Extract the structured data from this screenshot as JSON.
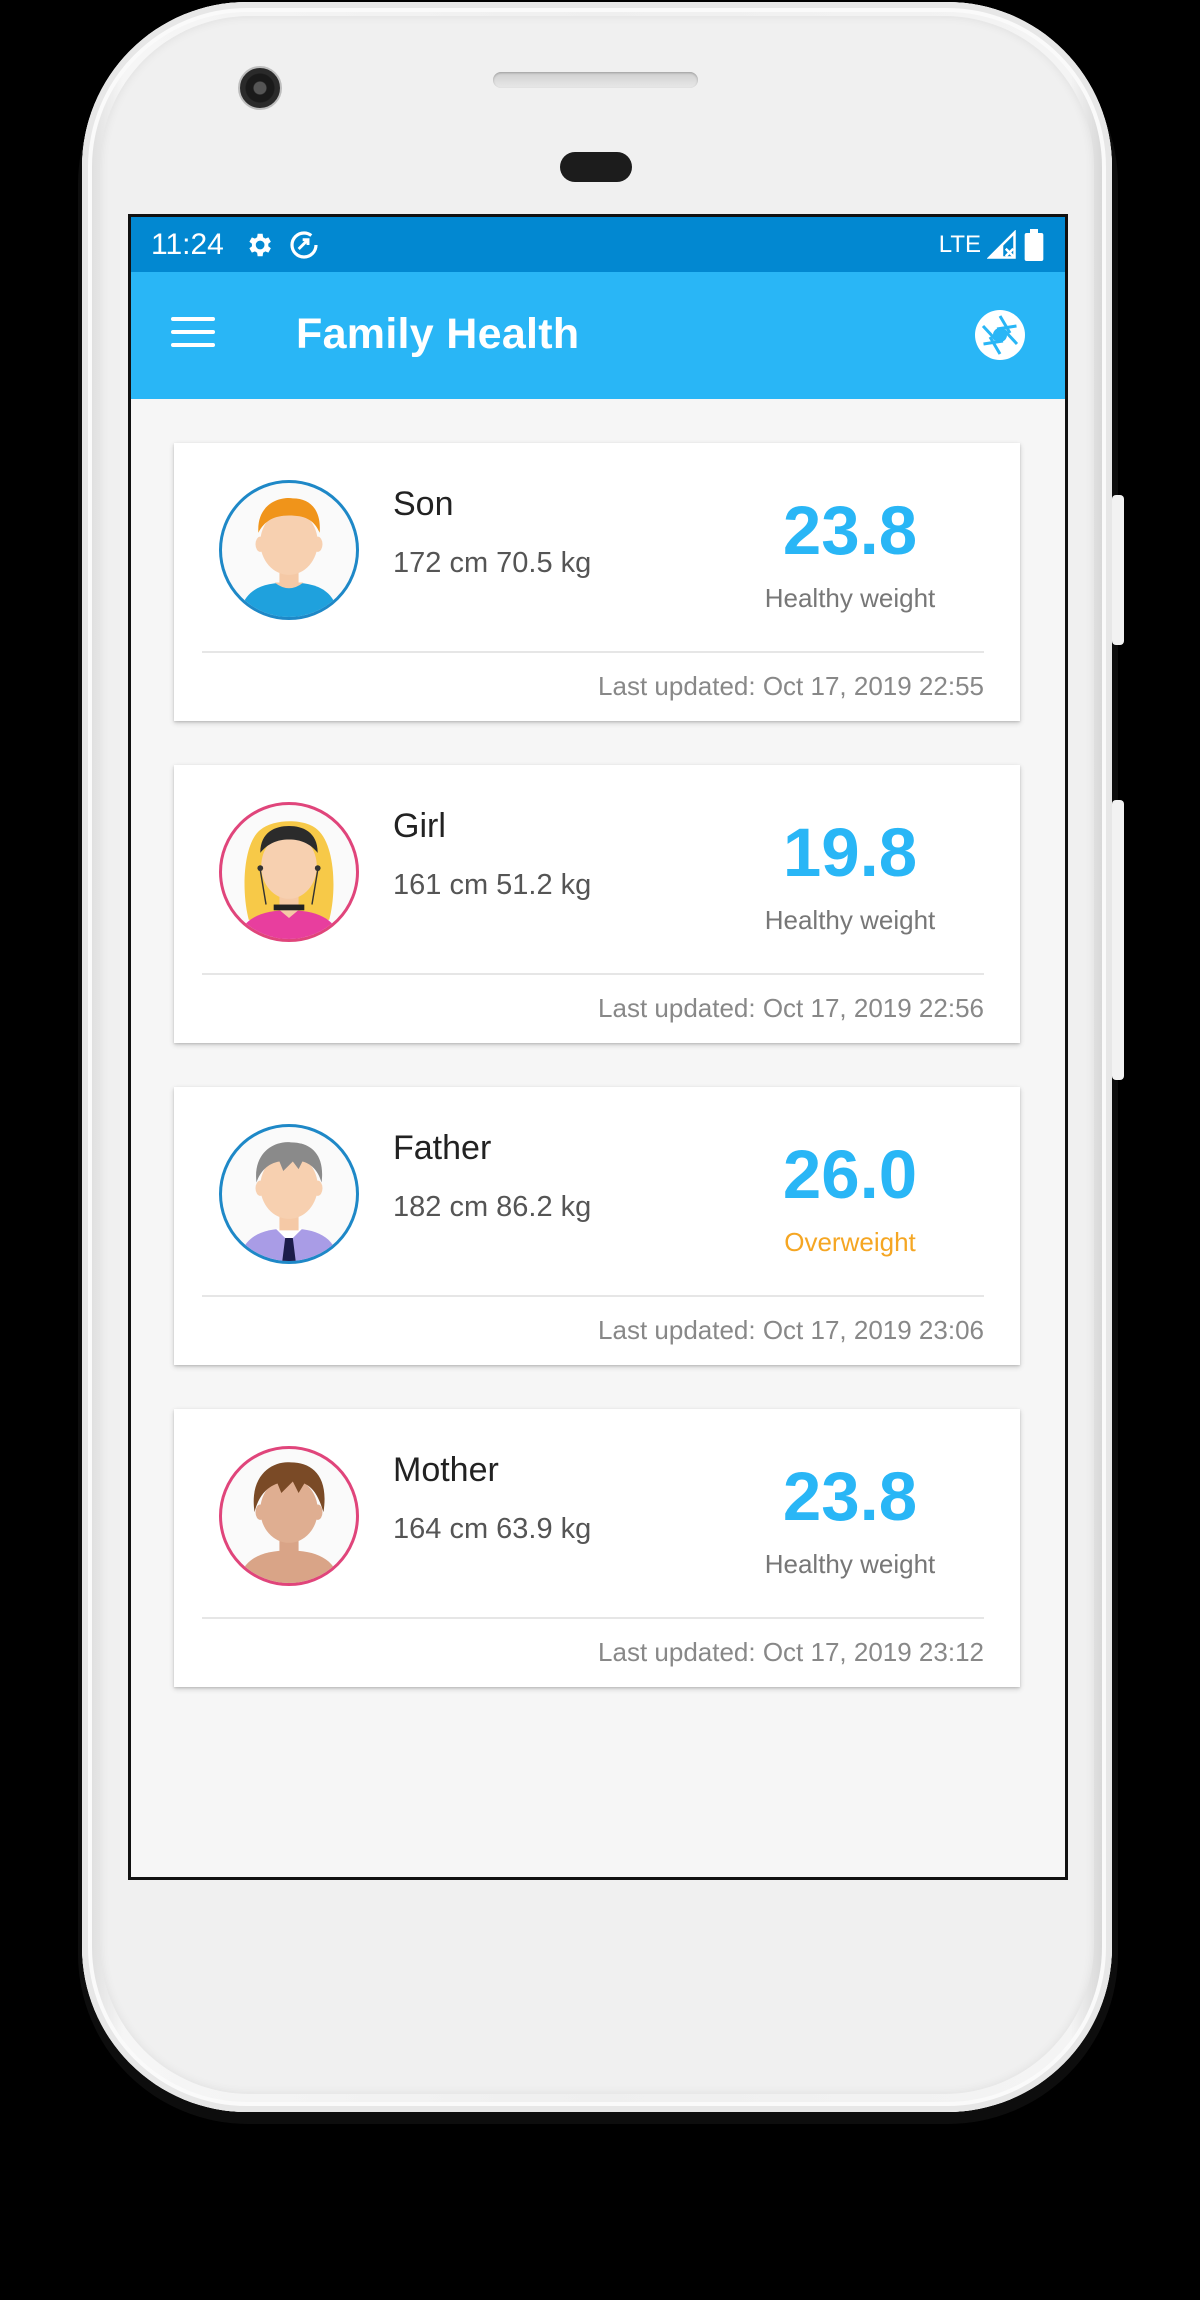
{
  "status_bar": {
    "time": "11:24",
    "network": "LTE",
    "icons": [
      "gear-icon",
      "data-saver-icon",
      "signal-icon",
      "battery-icon"
    ]
  },
  "app_bar": {
    "title": "Family Health",
    "menu_icon": "hamburger-menu-icon",
    "action_icon": "camera-shutter-icon"
  },
  "colors": {
    "status_bar": "#0288d1",
    "app_bar": "#29b6f6",
    "bmi_healthy": "#29b6f6",
    "overweight_text": "#f5a623",
    "male_ring": "#1e88c7",
    "female_ring": "#e0457b"
  },
  "members": [
    {
      "name": "Son",
      "stats": "172 cm 70.5 kg",
      "bmi": "23.8",
      "status": "Healthy weight",
      "updated": "Last updated: Oct 17, 2019 22:55",
      "avatar": "boy-avatar"
    },
    {
      "name": "Girl",
      "stats": "161 cm 51.2 kg",
      "bmi": "19.8",
      "status": "Healthy weight",
      "updated": "Last updated: Oct 17, 2019 22:56",
      "avatar": "girl-avatar"
    },
    {
      "name": "Father",
      "stats": "182 cm 86.2 kg",
      "bmi": "26.0",
      "status": "Overweight",
      "updated": "Last updated: Oct 17, 2019 23:06",
      "avatar": "man-avatar"
    },
    {
      "name": "Mother",
      "stats": "164 cm 63.9 kg",
      "bmi": "23.8",
      "status": "Healthy weight",
      "updated": "Last updated: Oct 17, 2019 23:12",
      "avatar": "woman-avatar"
    }
  ]
}
